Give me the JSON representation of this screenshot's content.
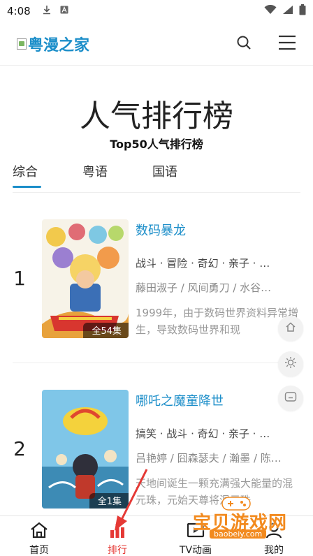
{
  "status_bar": {
    "time": "4:08"
  },
  "header": {
    "logo_text": "粤漫之家"
  },
  "page": {
    "title": "人气排行榜",
    "subtitle": "Top50人气排行榜"
  },
  "tabs": [
    {
      "label": "综合",
      "active": true
    },
    {
      "label": "粤语",
      "active": false
    },
    {
      "label": "国语",
      "active": false
    }
  ],
  "items": [
    {
      "rank": "1",
      "name": "数码暴龙",
      "count": "全54集",
      "tags": "战斗 · 冒险 · 奇幻 · 亲子 · …",
      "authors": "藤田淑子 / 风间勇刀 / 水谷…",
      "desc": "1999年，由于数码世界资料异常增生，导致数码世界和现"
    },
    {
      "rank": "2",
      "name": "哪吒之魔童降世",
      "count": "全1集",
      "tags": "搞笑 · 战斗 · 奇幻 · 亲子 · …",
      "authors": "吕艳婷 / 囧森瑟夫 / 瀚墨 / 陈…",
      "desc": "天地间诞生一颗充满强大能量的混元珠，元始天尊将混元珠"
    }
  ],
  "nav": [
    {
      "label": "首页",
      "icon": "home-icon",
      "active": false
    },
    {
      "label": "排行",
      "icon": "ranking-icon",
      "active": true
    },
    {
      "label": "TV动画",
      "icon": "tv-icon",
      "active": false
    },
    {
      "label": "我的",
      "icon": "user-icon",
      "active": false
    }
  ],
  "watermark": {
    "text": "宝贝游戏网",
    "url": "baobeiy.com"
  },
  "colors": {
    "accent": "#1c8ec9",
    "nav_active": "#e53935",
    "watermark": "#f28a1e"
  }
}
